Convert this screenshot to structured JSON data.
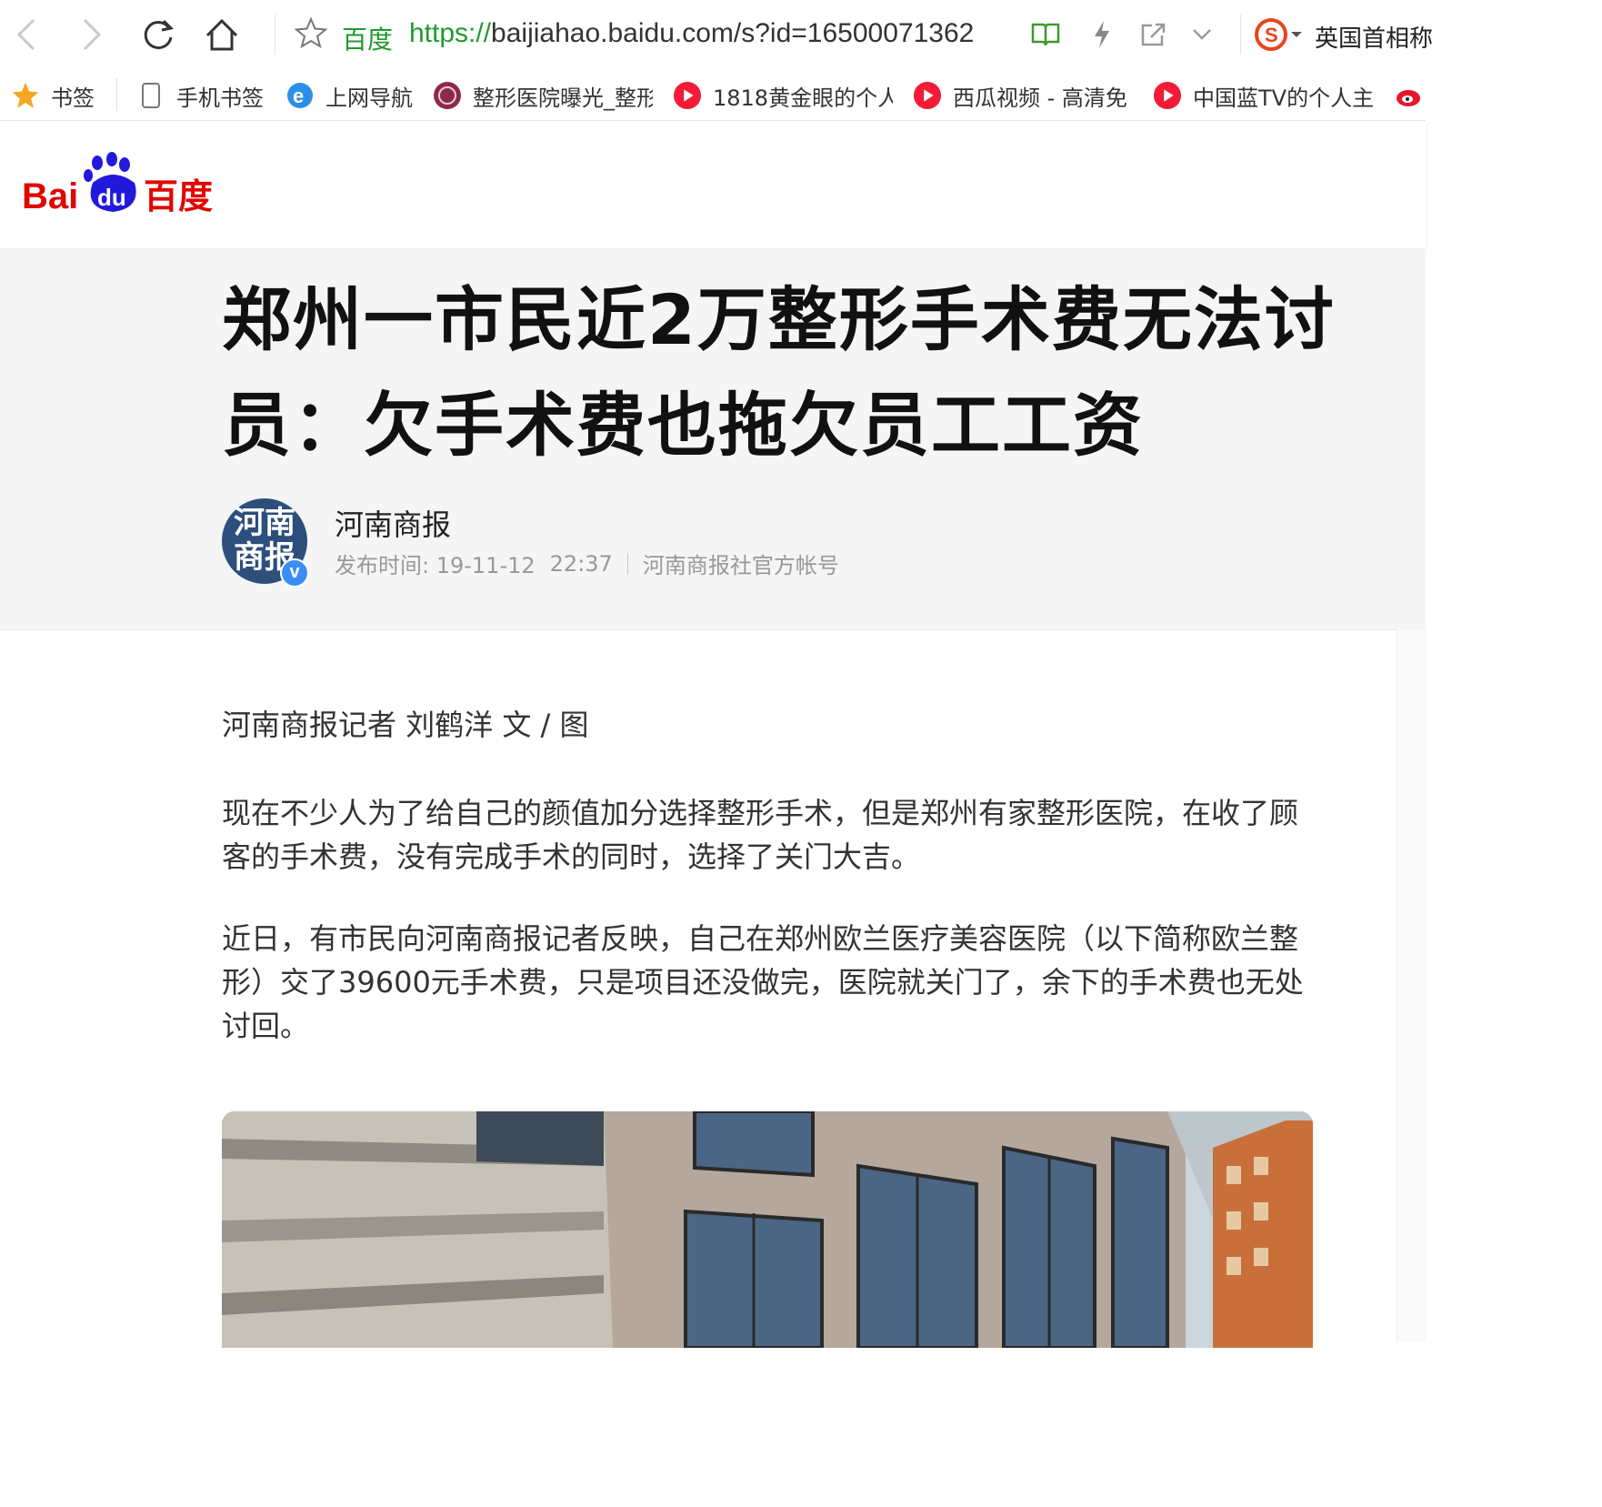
{
  "browser": {
    "site_name": "百度",
    "url_protocol": "https://",
    "url_rest": "baijiahao.baidu.com/s?id=16500071362",
    "search_box_text": "英国首相称",
    "icons": [
      "back-icon",
      "forward-icon",
      "refresh-icon",
      "home-icon",
      "star-icon",
      "reader-icon",
      "lightning-icon",
      "share-icon",
      "chevron-down-icon",
      "sogou-icon"
    ]
  },
  "bookmarks": [
    {
      "label": "书签",
      "icon": "star-icon"
    },
    {
      "label": "手机书签",
      "icon": "phone-icon"
    },
    {
      "label": "上网导航",
      "icon": "ie-icon"
    },
    {
      "label": "整形医院曝光_整形",
      "icon": "clinic-icon"
    },
    {
      "label": "1818黄金眼的个人",
      "icon": "video-icon"
    },
    {
      "label": "西瓜视频 - 高清免",
      "icon": "video-icon"
    },
    {
      "label": "中国蓝TV的个人主",
      "icon": "video-icon"
    }
  ],
  "header": {
    "logo_text_bai": "Bai",
    "logo_text_du": "du",
    "logo_text_cn": "百度"
  },
  "article": {
    "title_line1": "郑州一市民近2万整形手术费无法讨",
    "title_line2": "员：欠手术费也拖欠员工工资",
    "author": "河南商报",
    "avatar_text": "河南商报",
    "avatar_line1": "河南",
    "avatar_line2": "商报",
    "verified_mark": "v",
    "publish_label": "发布时间: 19-11-12",
    "publish_time": "22:37",
    "account_desc": "河南商报社官方帐号",
    "byline": "河南商报记者 刘鹤洋 文 / 图",
    "paragraphs": [
      "现在不少人为了给自己的颜值加分选择整形手术，但是郑州有家整形医院，在收了顾客的手术费，没有完成手术的同时，选择了关门大吉。",
      "近日，有市民向河南商报记者反映，自己在郑州欧兰医疗美容医院（以下简称欧兰整形）交了39600元手术费，只是项目还没做完，医院就关门了，余下的手术费也无处讨回。"
    ]
  },
  "colors": {
    "baidu_red": "#e10601",
    "baidu_blue": "#2319dc",
    "url_green": "#1f9a2e",
    "avatar_bg": "#2c4f7c"
  }
}
